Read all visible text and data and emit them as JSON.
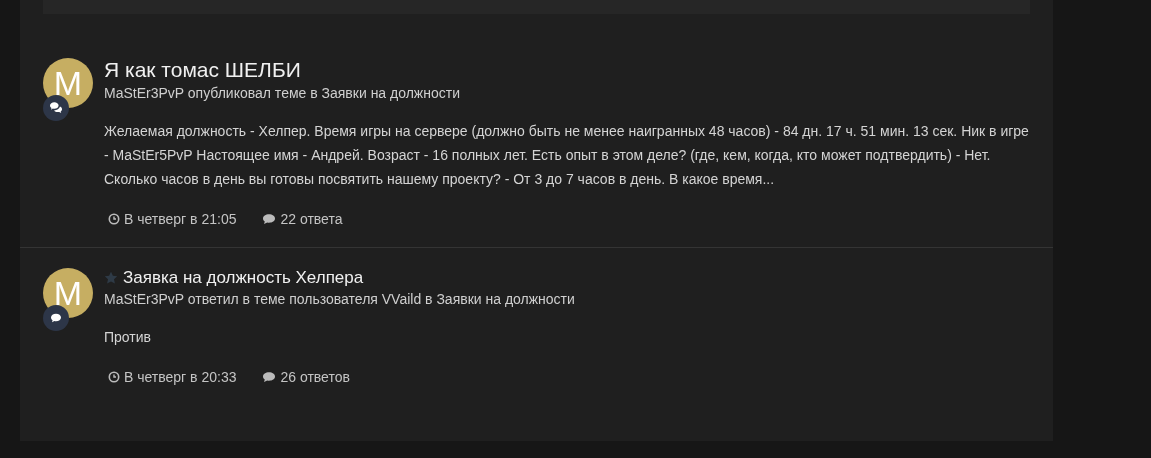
{
  "activity": [
    {
      "kind": "topic",
      "avatar_letter": "M",
      "featured": false,
      "title": "Я как томас ШЕЛБИ",
      "meta": "MaStEr3PvP опубликовал теме в Заявки на должности",
      "excerpt": "Желаемая должность - Хелпер. Время игры на сервере (должно быть не менее наигранных 48 часов) - 84 дн. 17 ч. 51 мин. 13 сек. Ник в игре - MaStEr5PvP Настоящее имя - Андрей. Возраст - 16 полных лет. Есть опыт в этом деле? (где, кем, когда, кто может подтвердить) - Нет. Сколько часов в день вы готовы посвятить нашему проекту? - От 3 до 7 часов в день. В какое время...",
      "time": "В четверг в 21:05",
      "replies": "22 ответа"
    },
    {
      "kind": "reply",
      "avatar_letter": "M",
      "featured": true,
      "title": "Заявка на должность Хелпера",
      "meta": "MaStEr3PvP ответил в теме пользователя VVaild в Заявки на должности",
      "excerpt": "Против",
      "time": "В четверг в 20:33",
      "replies": "26 ответов"
    }
  ]
}
